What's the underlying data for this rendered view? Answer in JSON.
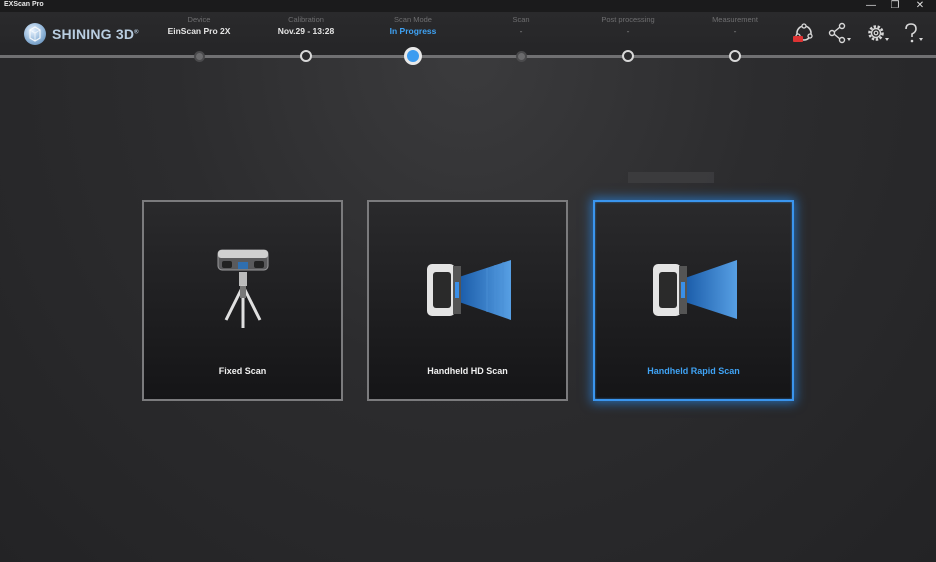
{
  "window": {
    "title": "EXScan Pro",
    "controls": {
      "minimize": "—",
      "restore": "❐",
      "close": "✕"
    }
  },
  "brand": {
    "name": "SHINING 3D",
    "mark": "®"
  },
  "steps": [
    {
      "label": "Device",
      "value": "EinScan Pro 2X",
      "state": "pending"
    },
    {
      "label": "Calibration",
      "value": "Nov.29 - 13:28",
      "state": "done"
    },
    {
      "label": "Scan Mode",
      "value": "In Progress",
      "state": "current"
    },
    {
      "label": "Scan",
      "value": "-",
      "state": "pending"
    },
    {
      "label": "Post processing",
      "value": "-",
      "state": "done"
    },
    {
      "label": "Measurement",
      "value": "-",
      "state": "done"
    }
  ],
  "toolbar": [
    {
      "icon": "remote-service-icon"
    },
    {
      "icon": "share-icon"
    },
    {
      "icon": "settings-gear-icon"
    },
    {
      "icon": "help-icon"
    }
  ],
  "scan_modes": [
    {
      "label": "Fixed Scan",
      "icon": "tripod-scanner-icon",
      "selected": false
    },
    {
      "label": "Handheld HD Scan",
      "icon": "handheld-scanner-hd-icon",
      "selected": false
    },
    {
      "label": "Handheld Rapid Scan",
      "icon": "handheld-scanner-rapid-icon",
      "selected": true
    }
  ],
  "colors": {
    "accent": "#3fa3f5",
    "selected_border": "#3a95ee",
    "background": "#2c2c2e"
  }
}
